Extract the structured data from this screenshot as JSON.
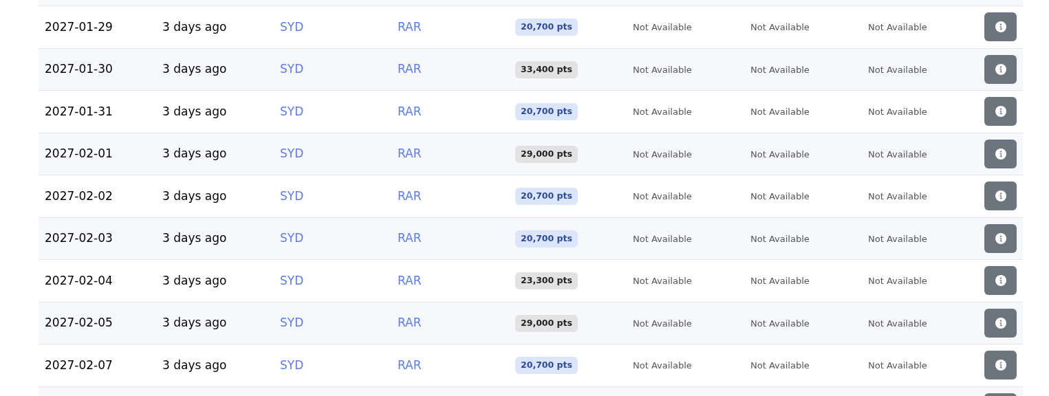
{
  "table": {
    "rows": [
      {
        "date": "2027-01-29",
        "age": "3 days ago",
        "origin": "SYD",
        "destination": "RAR",
        "points": "20,700 pts",
        "color": "#dbe5fb",
        "column_6": "Not Available",
        "column_7": "Not Available",
        "column_8": "Not Available"
      },
      {
        "date": "2027-01-30",
        "age": "3 days ago",
        "origin": "SYD",
        "destination": "RAR",
        "points": "33,400 pts",
        "color": "#e2e2e2",
        "column_6": "Not Available",
        "column_7": "Not Available",
        "column_8": "Not Available"
      },
      {
        "date": "2027-01-31",
        "age": "3 days ago",
        "origin": "SYD",
        "destination": "RAR",
        "points": "20,700 pts",
        "color": "#dbe5fb",
        "column_6": "Not Available",
        "column_7": "Not Available",
        "column_8": "Not Available"
      },
      {
        "date": "2027-02-01",
        "age": "3 days ago",
        "origin": "SYD",
        "destination": "RAR",
        "points": "29,000 pts",
        "color": "#e2e2e2",
        "column_6": "Not Available",
        "column_7": "Not Available",
        "column_8": "Not Available"
      },
      {
        "date": "2027-02-02",
        "age": "3 days ago",
        "origin": "SYD",
        "destination": "RAR",
        "points": "20,700 pts",
        "color": "#dbe5fb",
        "column_6": "Not Available",
        "column_7": "Not Available",
        "column_8": "Not Available"
      },
      {
        "date": "2027-02-03",
        "age": "3 days ago",
        "origin": "SYD",
        "destination": "RAR",
        "points": "20,700 pts",
        "color": "#dbe5fb",
        "column_6": "Not Available",
        "column_7": "Not Available",
        "column_8": "Not Available"
      },
      {
        "date": "2027-02-04",
        "age": "3 days ago",
        "origin": "SYD",
        "destination": "RAR",
        "points": "23,300 pts",
        "color": "#e2e2e2",
        "column_6": "Not Available",
        "column_7": "Not Available",
        "column_8": "Not Available"
      },
      {
        "date": "2027-02-05",
        "age": "3 days ago",
        "origin": "SYD",
        "destination": "RAR",
        "points": "29,000 pts",
        "color": "#e2e2e2",
        "column_6": "Not Available",
        "column_7": "Not Available",
        "column_8": "Not Available"
      },
      {
        "date": "2027-02-07",
        "age": "3 days ago",
        "origin": "SYD",
        "destination": "RAR",
        "points": "20,700 pts",
        "color": "#dbe5fb",
        "column_6": "Not Available",
        "column_7": "Not Available",
        "column_8": "Not Available"
      }
    ]
  }
}
